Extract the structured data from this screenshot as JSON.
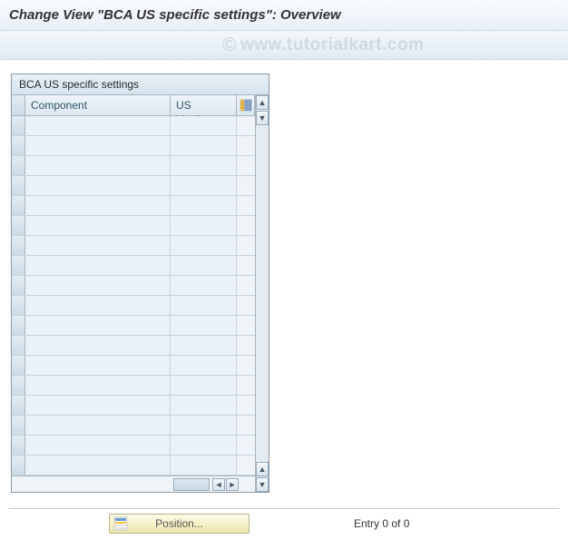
{
  "title": "Change View \"BCA US specific settings\": Overview",
  "watermark": "www.tutorialkart.com",
  "table": {
    "title": "BCA US specific settings",
    "columns": {
      "component": "Component",
      "usversion": "US Version"
    },
    "row_count": 18
  },
  "footer": {
    "position_label": "Position...",
    "entry_text": "Entry 0 of 0"
  }
}
